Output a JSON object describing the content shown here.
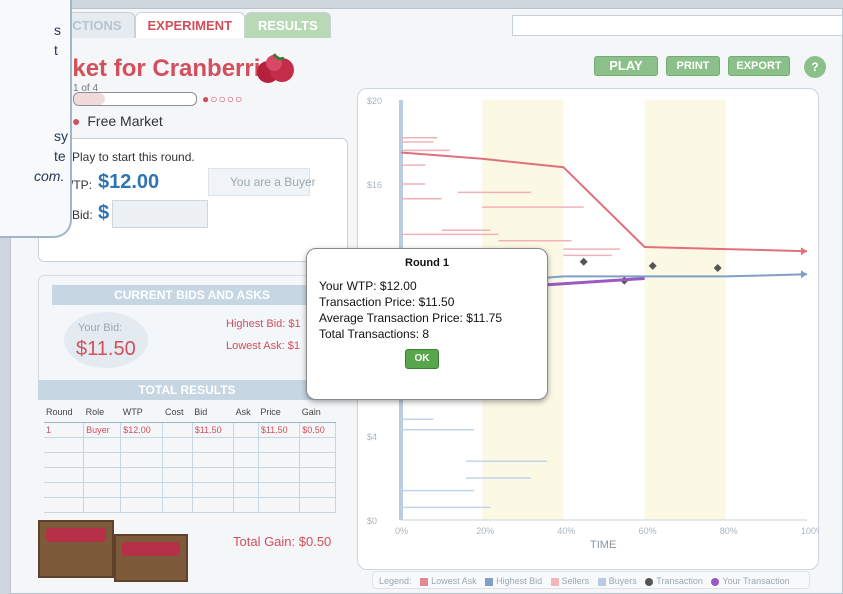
{
  "tabs": [
    {
      "label": "UCTIONS"
    },
    {
      "label": "EXPERIMENT"
    },
    {
      "label": "RESULTS"
    }
  ],
  "left": {
    "title": "rket for Cranberries",
    "round_label": "1 of 4",
    "round_progress": 0.25,
    "market_type": "Free Market",
    "prompt": "Play to start this round.",
    "wtp_label": "WTP:",
    "wtp_value": "$12.00",
    "buyer_note": "You are a Buyer",
    "bid_label": "Bid:",
    "bid_dollar": "$",
    "bid_value": ""
  },
  "callout_text": [
    "s",
    "t",
    "",
    "sy",
    "te",
    "com."
  ],
  "current_bids": {
    "title": "CURRENT BIDS AND ASKS",
    "your_bid_label": "Your Bid:",
    "your_bid_value": "$11.50",
    "highest_bid": "Highest Bid: $1",
    "lowest_ask": "Lowest Ask: $1"
  },
  "total_results": {
    "title": "TOTAL RESULTS",
    "columns": [
      "Round",
      "Role",
      "WTP",
      "Cost",
      "Bid",
      "Ask",
      "Price",
      "Gain"
    ],
    "rows": [
      [
        "1",
        "Buyer",
        "$12.00",
        "",
        "$11.50",
        "",
        "$11.50",
        "$0.50"
      ]
    ],
    "total_gain": "Total Gain: $0.50"
  },
  "toolbar": {
    "play": "PLAY",
    "print": "PRINT",
    "export": "EXPORT",
    "help": "?"
  },
  "modal": {
    "title": "Round 1",
    "your_wtp": "Your WTP: $12.00",
    "transaction_price": "Transaction Price: $11.50",
    "average_price": "Average Transaction Price: $11.75",
    "total_transactions": "Total Transactions: 8",
    "ok": "OK"
  },
  "legend": {
    "prefix": "Legend:",
    "items": [
      "Lowest Ask",
      "Highest Bid",
      "Sellers",
      "Buyers",
      "Transaction",
      "Your Transaction"
    ]
  },
  "colors": {
    "accent_red": "#d24f5b",
    "accent_blue": "#2f75b4",
    "button_green": "#8cc08a",
    "purple": "#9b59c4"
  },
  "chart_data": {
    "type": "line",
    "xlabel": "TIME",
    "x_ticks": [
      "0%",
      "20%",
      "40%",
      "60%",
      "80%",
      "100%"
    ],
    "y_ticks": [
      "$0",
      "$4",
      "$16",
      "$20"
    ],
    "xlim": [
      0,
      100
    ],
    "ylim": [
      0,
      20
    ],
    "series": [
      {
        "name": "Lowest Ask",
        "values": [
          [
            0,
            17.5
          ],
          [
            20,
            17.2
          ],
          [
            40,
            16.8
          ],
          [
            60,
            13.0
          ],
          [
            80,
            12.9
          ],
          [
            100,
            12.8
          ]
        ]
      },
      {
        "name": "Highest Bid",
        "values": [
          [
            0,
            11.0
          ],
          [
            20,
            11.3
          ],
          [
            40,
            11.6
          ],
          [
            60,
            11.6
          ],
          [
            80,
            11.6
          ],
          [
            100,
            11.7
          ]
        ]
      },
      {
        "name": "Transaction",
        "values": [
          [
            45,
            12.3
          ],
          [
            55,
            11.4
          ],
          [
            62,
            12.1
          ],
          [
            78,
            12.0
          ]
        ]
      },
      {
        "name": "Your Transaction",
        "values": [
          [
            28,
            11.1
          ],
          [
            60,
            11.5
          ]
        ]
      }
    ]
  }
}
